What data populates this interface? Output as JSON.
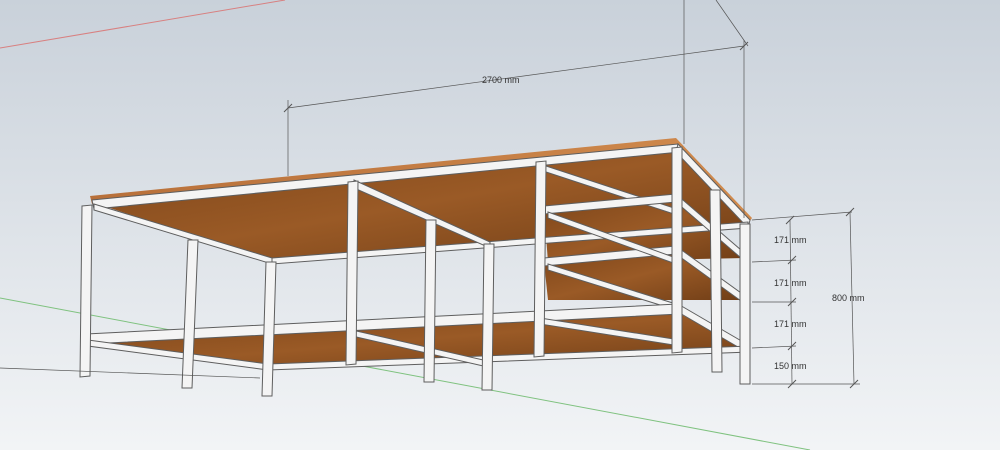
{
  "dimensions": {
    "overall_length": "2700 mm",
    "overall_height": "800 mm",
    "shelf_spacing_1": "171 mm",
    "shelf_spacing_2": "171 mm",
    "shelf_spacing_3": "171 mm",
    "bottom_clearance": "150 mm"
  },
  "colors": {
    "sky_top": "#c9d1da",
    "sky_bottom": "#f2f4f6",
    "wood": "#8a4e21",
    "wood_top": "#c27a3f",
    "steel": "#f4f4f4",
    "steel_edge": "#5e5e5e",
    "axis_red": "#d88080",
    "axis_green": "#7fc27f"
  }
}
